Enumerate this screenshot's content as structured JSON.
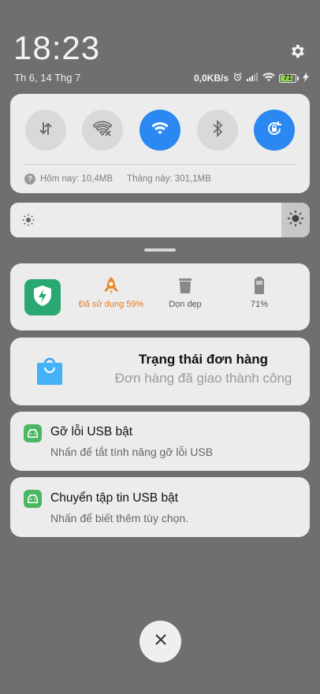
{
  "status_bar": {
    "time": "18:23",
    "date": "Th 6, 14 Thg 7",
    "network_speed": "0,0KB/s",
    "battery_level": "71",
    "icons": [
      "alarm-icon",
      "signal-icon",
      "wifi-icon",
      "battery-icon",
      "charging-icon"
    ]
  },
  "quick_settings": {
    "toggles": [
      {
        "name": "mobile-data",
        "icon": "data-transfer-icon",
        "active": false
      },
      {
        "name": "wifi-hotspot",
        "icon": "wifi-off-icon",
        "active": false
      },
      {
        "name": "wifi",
        "icon": "wifi-icon",
        "active": true
      },
      {
        "name": "bluetooth",
        "icon": "bluetooth-icon",
        "active": false
      },
      {
        "name": "auto-rotate",
        "icon": "rotate-lock-icon",
        "active": true
      }
    ],
    "usage_today": "Hôm nay: 10,4MB",
    "usage_month": "Tháng này: 301,1MB",
    "accent_color": "#2b87f1"
  },
  "brightness": {
    "level": 1.0
  },
  "security_card": {
    "items": [
      {
        "label": "Đã sử dụng 59%",
        "color": "#e07b1c"
      },
      {
        "label": "Dọn dẹp",
        "color": "#555555"
      },
      {
        "label": "71%",
        "color": "#555555"
      }
    ]
  },
  "notifications": [
    {
      "title": "Trạng thái đơn hàng",
      "body": "Đơn hàng đã giao thành công"
    },
    {
      "title": "Gỡ lỗi USB bật",
      "body": "Nhấn để tắt tính năng gỡ lỗi USB"
    },
    {
      "title": "Chuyển tập tin USB bật",
      "body": "Nhấn để biết thêm tùy chọn."
    }
  ]
}
